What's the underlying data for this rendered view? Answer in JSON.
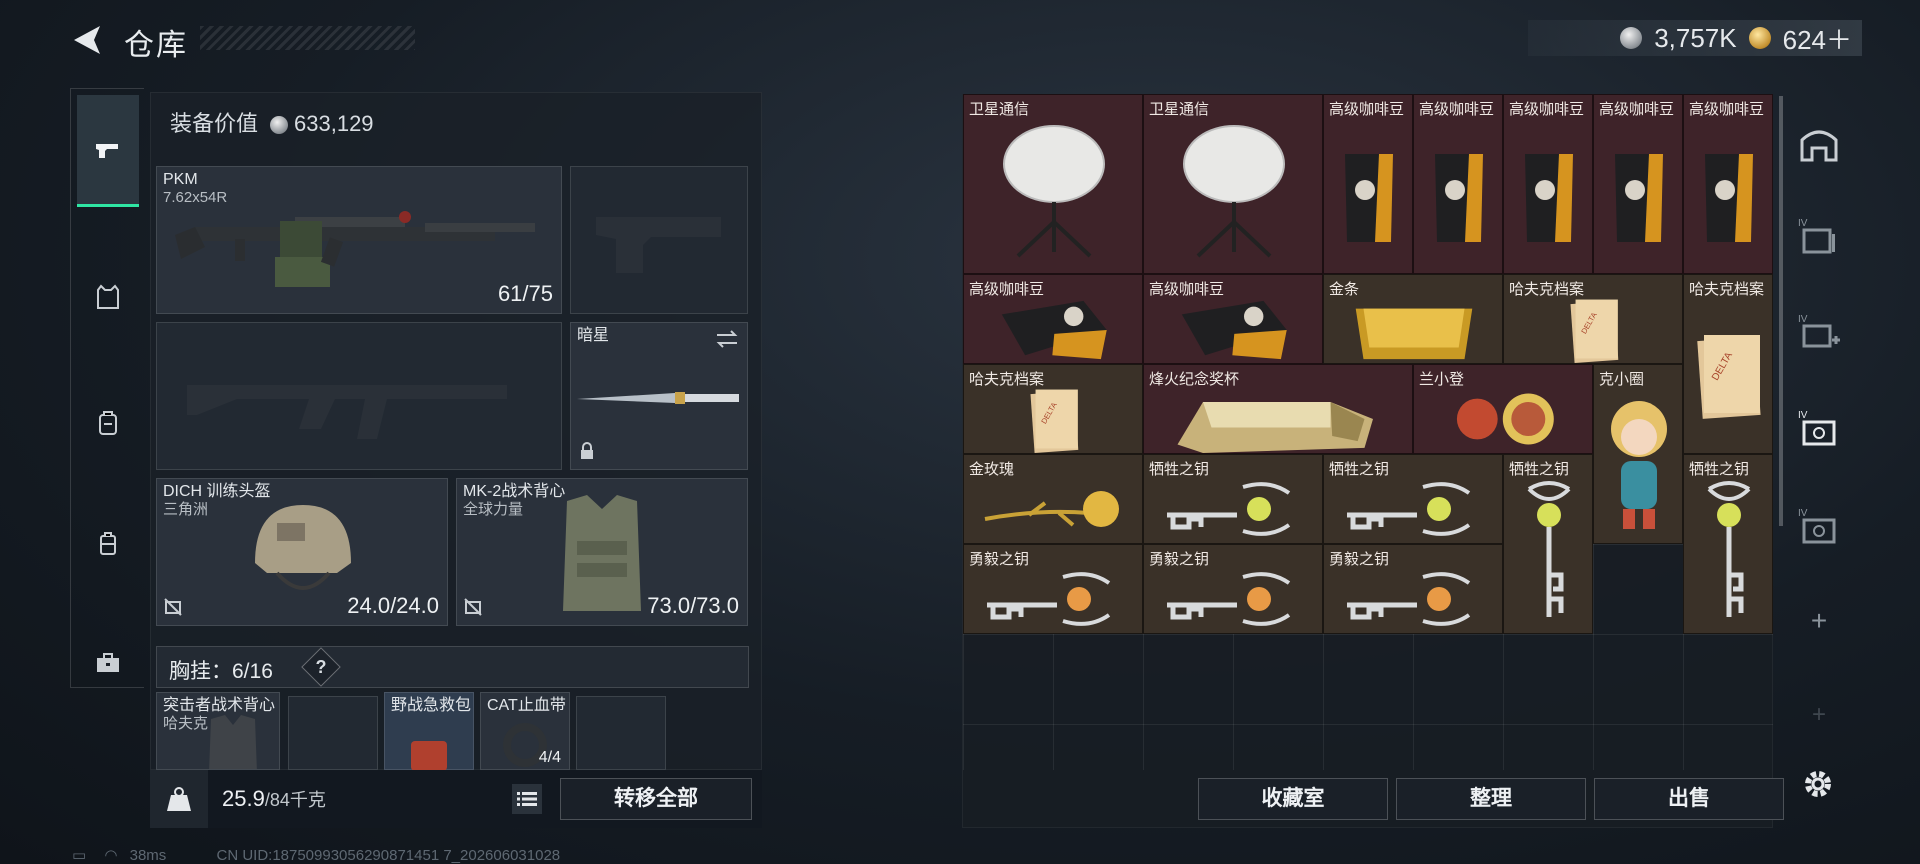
{
  "header": {
    "title": "仓库",
    "currency": [
      {
        "icon": "silver-coin-icon",
        "value": "3,757K"
      },
      {
        "icon": "gold-coin-icon",
        "value": "624＋"
      }
    ]
  },
  "left_tabs": [
    "pistol-icon",
    "vest-icon",
    "backpack-icon",
    "case-icon",
    "toolbox-icon"
  ],
  "loadout": {
    "equip_value_label": "装备价值",
    "equip_value": "633,129",
    "primary": {
      "name": "PKM",
      "caliber": "7.62x54R",
      "count": "61/75"
    },
    "melee": {
      "name": "暗星"
    },
    "helmet": {
      "name": "DICH 训练头盔",
      "sub": "三角洲",
      "durability": "24.0/24.0"
    },
    "armor": {
      "name": "MK-2战术背心",
      "sub": "全球力量",
      "durability": "73.0/73.0"
    },
    "chest_rig": {
      "label": "胸挂：6/16",
      "help": "?"
    },
    "pouch_items": [
      {
        "name": "突击者战术背心",
        "sub": "哈夫克"
      },
      {
        "name": ""
      },
      {
        "name": "野战急救包"
      },
      {
        "name": "CAT止血带",
        "count": "4/4"
      },
      {
        "name": ""
      }
    ],
    "weight": "25.9",
    "weight_max": "/84千克",
    "transfer_all": "转移全部"
  },
  "status": {
    "ping": "38ms",
    "uid": "CN UID:18750993056290871451 7_202606031028"
  },
  "warehouse": {
    "items": [
      {
        "name": "卫星通信",
        "bg": "red",
        "icon": "satellite-dish"
      },
      {
        "name": "卫星通信",
        "bg": "red",
        "icon": "satellite-dish"
      },
      {
        "name": "高级咖啡豆",
        "bg": "red",
        "icon": "coffee-bag"
      },
      {
        "name": "高级咖啡豆",
        "bg": "red",
        "icon": "coffee-bag"
      },
      {
        "name": "高级咖啡豆",
        "bg": "red",
        "icon": "coffee-bag"
      },
      {
        "name": "高级咖啡豆",
        "bg": "red",
        "icon": "coffee-bag"
      },
      {
        "name": "高级咖啡豆",
        "bg": "red",
        "icon": "coffee-bag"
      },
      {
        "name": "高级咖啡豆",
        "bg": "red",
        "icon": "coffee-bag-open"
      },
      {
        "name": "高级咖啡豆",
        "bg": "red",
        "icon": "coffee-bag-open"
      },
      {
        "name": "金条",
        "bg": "gold",
        "icon": "gold-bar"
      },
      {
        "name": "哈夫克档案",
        "bg": "gold",
        "icon": "folder"
      },
      {
        "name": "哈夫克档案",
        "bg": "gold",
        "icon": "folder"
      },
      {
        "name": "哈夫克档案",
        "bg": "gold",
        "icon": "folder"
      },
      {
        "name": "烽火纪念奖杯",
        "bg": "red",
        "icon": "trophy"
      },
      {
        "name": "兰小登",
        "bg": "red",
        "icon": "figure"
      },
      {
        "name": "克小圈",
        "bg": "gold",
        "icon": "doll"
      },
      {
        "name": "金玫瑰",
        "bg": "gold",
        "icon": "gold-rose"
      },
      {
        "name": "牺牲之钥",
        "bg": "gold",
        "icon": "key"
      },
      {
        "name": "牺牲之钥",
        "bg": "gold",
        "icon": "key"
      },
      {
        "name": "牺牲之钥",
        "bg": "gold",
        "icon": "key-vertical"
      },
      {
        "name": "牺牲之钥",
        "bg": "gold",
        "icon": "key-vertical"
      },
      {
        "name": "勇毅之钥",
        "bg": "gold",
        "icon": "key-orange"
      },
      {
        "name": "勇毅之钥",
        "bg": "gold",
        "icon": "key-orange"
      },
      {
        "name": "勇毅之钥",
        "bg": "gold",
        "icon": "key-orange"
      }
    ]
  },
  "actions": [
    "收藏室",
    "整理",
    "出售"
  ],
  "right_rail": [
    "shop-icon",
    "storage-iv-icon",
    "storage-iv-add-icon",
    "storage-iv-active-icon",
    "storage-iv-locked-icon",
    "add-icon",
    "add-icon-dim"
  ]
}
